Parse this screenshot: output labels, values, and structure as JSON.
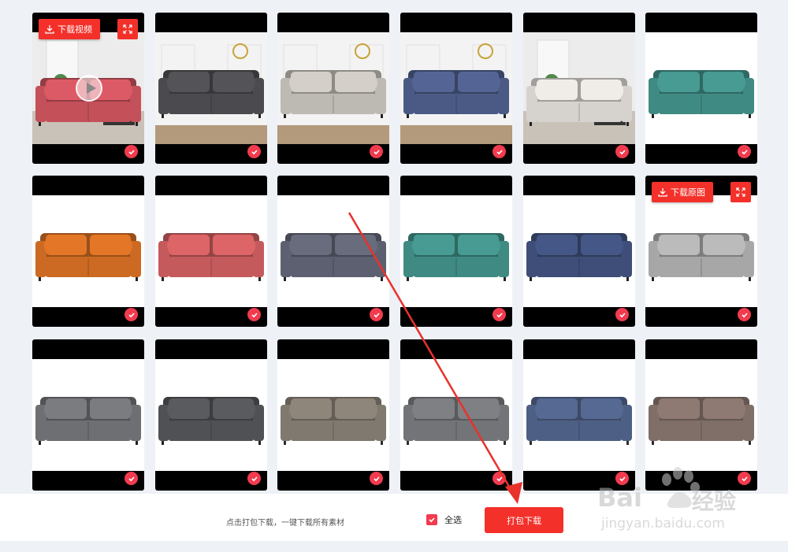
{
  "overlay": {
    "download_video_label": "下载视频",
    "download_original_label": "下载原图"
  },
  "footer": {
    "hint": "点击打包下载，一键下载所有素材",
    "select_all_label": "全选",
    "select_all_checked": true,
    "pack_download_label": "打包下载"
  },
  "watermark": {
    "brand_left": "Bai",
    "brand_right": "经验",
    "url": "jingyan.baidu.com"
  },
  "colors": {
    "accent": "#f3312a",
    "check": "#f23b4e"
  },
  "grid": {
    "rows": [
      [
        {
          "kind": "scene-room",
          "fabric": "#c4505a",
          "selected": true,
          "icon": "play-icon"
        },
        {
          "kind": "scene-sofa",
          "fabric": "#4b4b4f",
          "selected": true
        },
        {
          "kind": "scene-sofa",
          "fabric": "#bdb9b3",
          "selected": true
        },
        {
          "kind": "scene-sofa",
          "fabric": "#4b5a85",
          "selected": true
        },
        {
          "kind": "scene-room",
          "fabric": "#d6d3cf",
          "selected": true
        },
        {
          "kind": "sofa",
          "fabric": "#3f8a83",
          "selected": true
        }
      ],
      [
        {
          "kind": "sofa",
          "fabric": "#cc6a23",
          "selected": true
        },
        {
          "kind": "sofa",
          "fabric": "#c55a5c",
          "selected": true
        },
        {
          "kind": "sofa",
          "fabric": "#5d6070",
          "selected": true
        },
        {
          "kind": "sofa",
          "fabric": "#3f8a83",
          "selected": true
        },
        {
          "kind": "sofa",
          "fabric": "#3e4e78",
          "selected": true
        },
        {
          "kind": "sofa",
          "fabric": "#a7a7a7",
          "selected": true
        }
      ],
      [
        {
          "kind": "sofa",
          "fabric": "#6d6f72",
          "selected": true
        },
        {
          "kind": "sofa",
          "fabric": "#505154",
          "selected": true
        },
        {
          "kind": "sofa-textured",
          "fabric": "#7a7268",
          "selected": true
        },
        {
          "kind": "sofa-textured",
          "fabric": "#6c6d70",
          "selected": true
        },
        {
          "kind": "sofa-textured",
          "fabric": "#44577e",
          "selected": true
        },
        {
          "kind": "sofa-textured",
          "fabric": "#7a6760",
          "selected": true
        }
      ]
    ]
  }
}
